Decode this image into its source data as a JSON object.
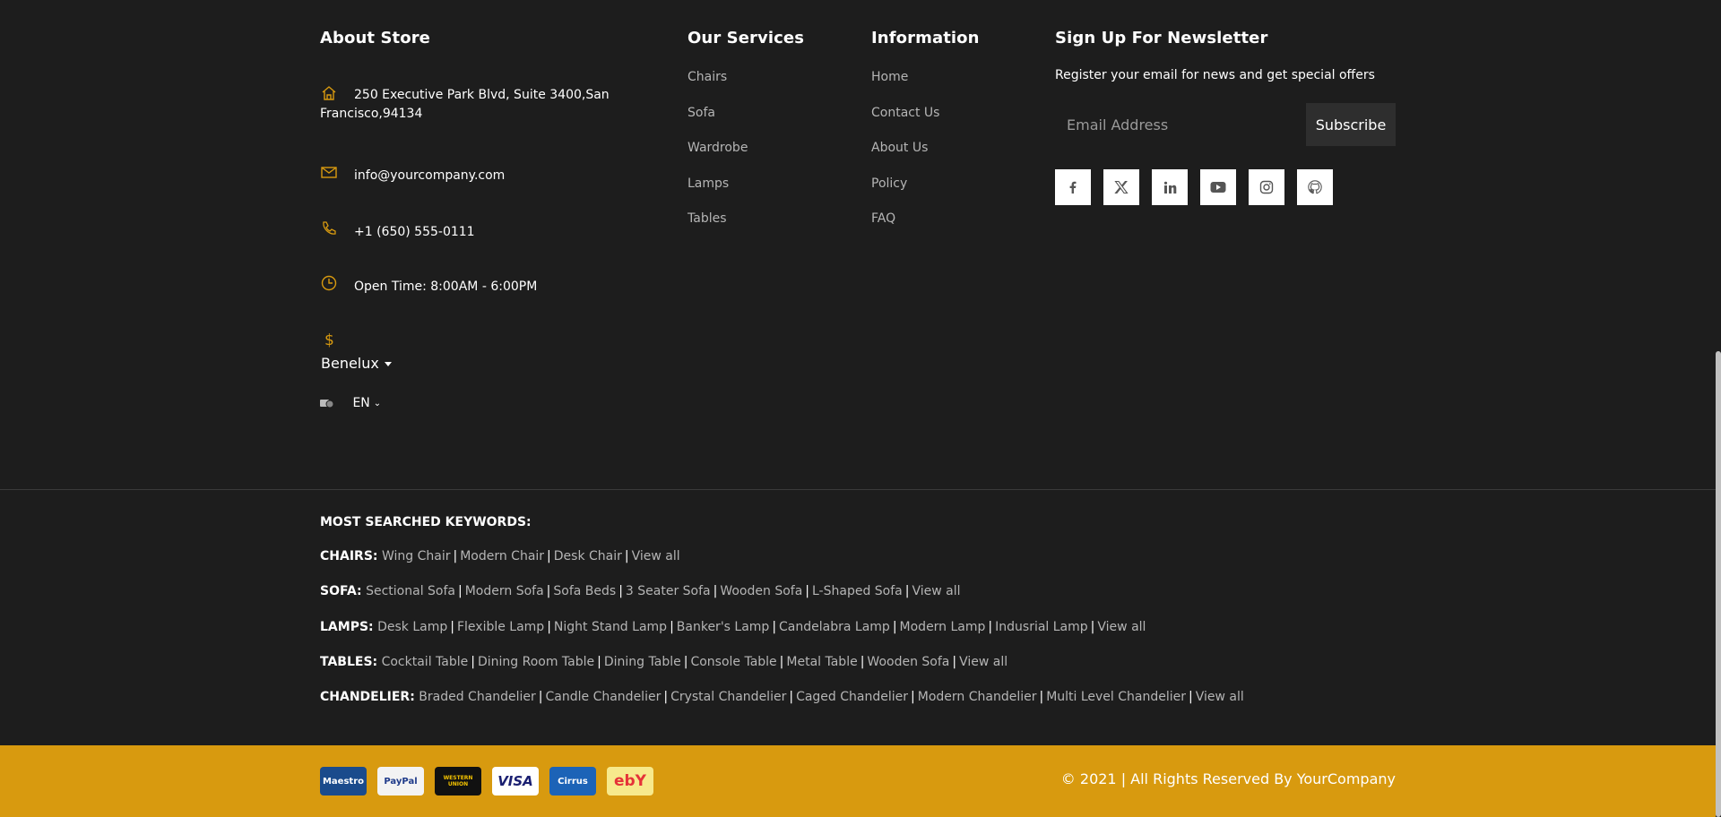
{
  "about": {
    "title": "About Store",
    "address": "250 Executive Park Blvd, Suite 3400,San Francisco,94134",
    "email": "info@yourcompany.com",
    "phone": "+1 (650) 555-0111",
    "hours": "Open Time: 8:00AM - 6:00PM",
    "currency": "Benelux",
    "language": "EN"
  },
  "services": {
    "title": "Our Services",
    "items": [
      "Chairs",
      "Sofa",
      "Wardrobe",
      "Lamps",
      "Tables"
    ]
  },
  "information": {
    "title": "Information",
    "items": [
      "Home",
      "Contact Us",
      "About Us",
      "Policy",
      "FAQ"
    ]
  },
  "newsletter": {
    "title": "Sign Up For Newsletter",
    "description": "Register your email for news and get special offers",
    "placeholder": "Email Address",
    "button": "Subscribe",
    "socials": [
      "facebook-icon",
      "x-twitter-icon",
      "linkedin-icon",
      "youtube-icon",
      "instagram-icon",
      "github-icon"
    ]
  },
  "keywords": {
    "title": "MOST SEARCHED KEYWORDS:",
    "rows": [
      {
        "label": "CHAIRS:",
        "links": [
          "Wing Chair",
          "Modern Chair",
          "Desk Chair",
          "View all"
        ]
      },
      {
        "label": "SOFA:",
        "links": [
          "Sectional Sofa",
          "Modern Sofa",
          "Sofa Beds",
          "3 Seater Sofa",
          "Wooden Sofa",
          "L-Shaped Sofa",
          "View all"
        ]
      },
      {
        "label": "LAMPS:",
        "links": [
          "Desk Lamp",
          "Flexible Lamp",
          "Night Stand Lamp",
          "Banker's Lamp",
          "Candelabra Lamp",
          "Modern Lamp",
          "Indusrial Lamp",
          "View all"
        ]
      },
      {
        "label": "TABLES:",
        "links": [
          "Cocktail Table",
          "Dining Room Table",
          "Dining Table",
          "Console Table",
          "Metal Table",
          "Wooden Sofa",
          "View all"
        ]
      },
      {
        "label": "CHANDELIER:",
        "links": [
          "Braded Chandelier",
          "Candle Chandelier",
          "Crystal Chandelier",
          "Caged Chandelier",
          "Modern Chandelier",
          "Multi Level Chandelier",
          "View all"
        ]
      }
    ]
  },
  "footer": {
    "copyright": "© 2021 | All Rights Reserved By YourCompany",
    "payments": [
      {
        "name": "maestro-icon",
        "label": "Maestro",
        "bg": "#1a4b8c",
        "fg": "#ffffff"
      },
      {
        "name": "paypal-icon",
        "label": "PayPal",
        "bg": "#f3f3f3",
        "fg": "#1f3b8a"
      },
      {
        "name": "western-union-icon",
        "label": "WESTERN UNION",
        "bg": "#111111",
        "fg": "#f4c300"
      },
      {
        "name": "visa-icon",
        "label": "VISA",
        "bg": "#ffffff",
        "fg": "#1a1f71"
      },
      {
        "name": "cirrus-icon",
        "label": "Cirrus",
        "bg": "#1c63b7",
        "fg": "#ffffff"
      },
      {
        "name": "ebay-icon",
        "label": "ebY",
        "bg": "#f7e98c",
        "fg": "#e53238"
      }
    ]
  },
  "colors": {
    "background": "#1d1d1d",
    "accent": "#d89a0f",
    "muted_text": "#b5b5b5"
  }
}
